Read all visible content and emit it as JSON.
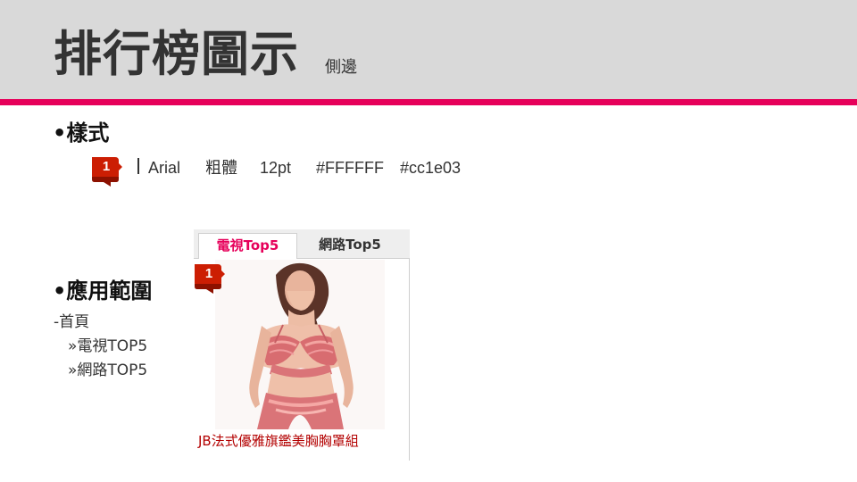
{
  "slide": {
    "title": "排行榜圖示",
    "subtitle": "側邊"
  },
  "style_section": {
    "heading": "•樣式",
    "rank_number": "1",
    "font": "Arial",
    "weight": "粗體",
    "size": "12pt",
    "text_color": "#FFFFFF",
    "badge_color": "#cc1e03"
  },
  "usage_section": {
    "heading": "•應用範圍",
    "items": [
      "-首頁",
      "»電視TOP5",
      "»網路TOP5"
    ]
  },
  "preview": {
    "tabs": [
      {
        "label": "電視Top5",
        "active": true
      },
      {
        "label": "網路Top5",
        "active": false
      }
    ],
    "rank_number": "1",
    "product_name": "JB法式優雅旗鑑美胸胸罩組",
    "image": "product-photo-lingerie-model"
  },
  "colors": {
    "header_background": "#d9d9d9",
    "accent": "#e6005a",
    "badge_red": "#cc1e03",
    "product_text": "#b30000"
  }
}
